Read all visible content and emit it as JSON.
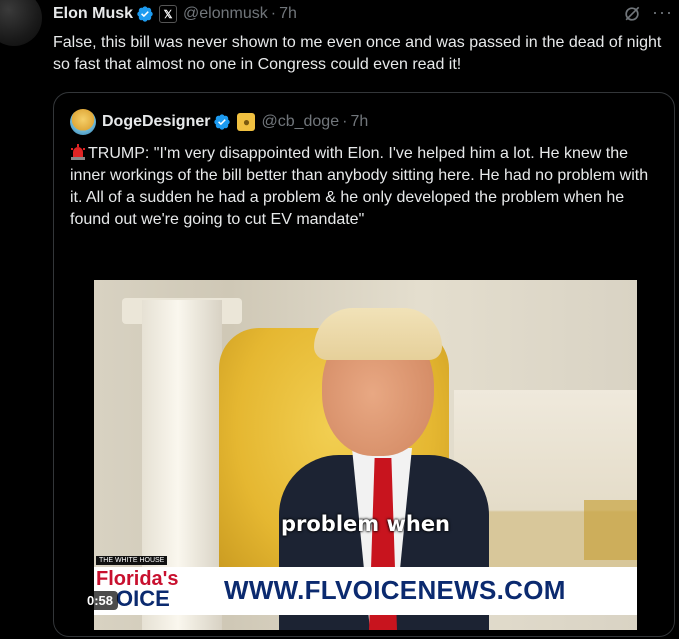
{
  "tweet": {
    "author_name": "Elon Musk",
    "author_handle": "@elonmusk",
    "separator": "·",
    "time": "7h",
    "x_badge": "𝕏",
    "text": "False, this bill was never shown to me even once and was passed in the dead of night so fast that almost no one in Congress could even read it!"
  },
  "quote": {
    "author_name": "DogeDesigner",
    "author_handle": "@cb_doge",
    "separator": "·",
    "time": "7h",
    "text": "TRUMP: \"I'm very disappointed with Elon. I've helped him a lot. He knew the inner workings of the bill better than anybody sitting here. He had no problem with it. All of a sudden he had a problem & he only developed the problem when he found out we're going to cut EV mandate\""
  },
  "video": {
    "caption": "problem when",
    "lower_third_small": "THE WHITE HOUSE",
    "logo_line1": "Florida's",
    "logo_line2": "OICE",
    "url": "WWW.FLVOICENEWS.COM",
    "duration": "0:58"
  },
  "icons": {
    "verified": "verified-badge-icon",
    "grok": "grok-icon",
    "more": "more-icon",
    "siren": "siren-icon"
  },
  "colors": {
    "background": "#000000",
    "text": "#e7e9ea",
    "secondary": "#71767b",
    "verified": "#1d9bf0",
    "border": "#333639"
  }
}
